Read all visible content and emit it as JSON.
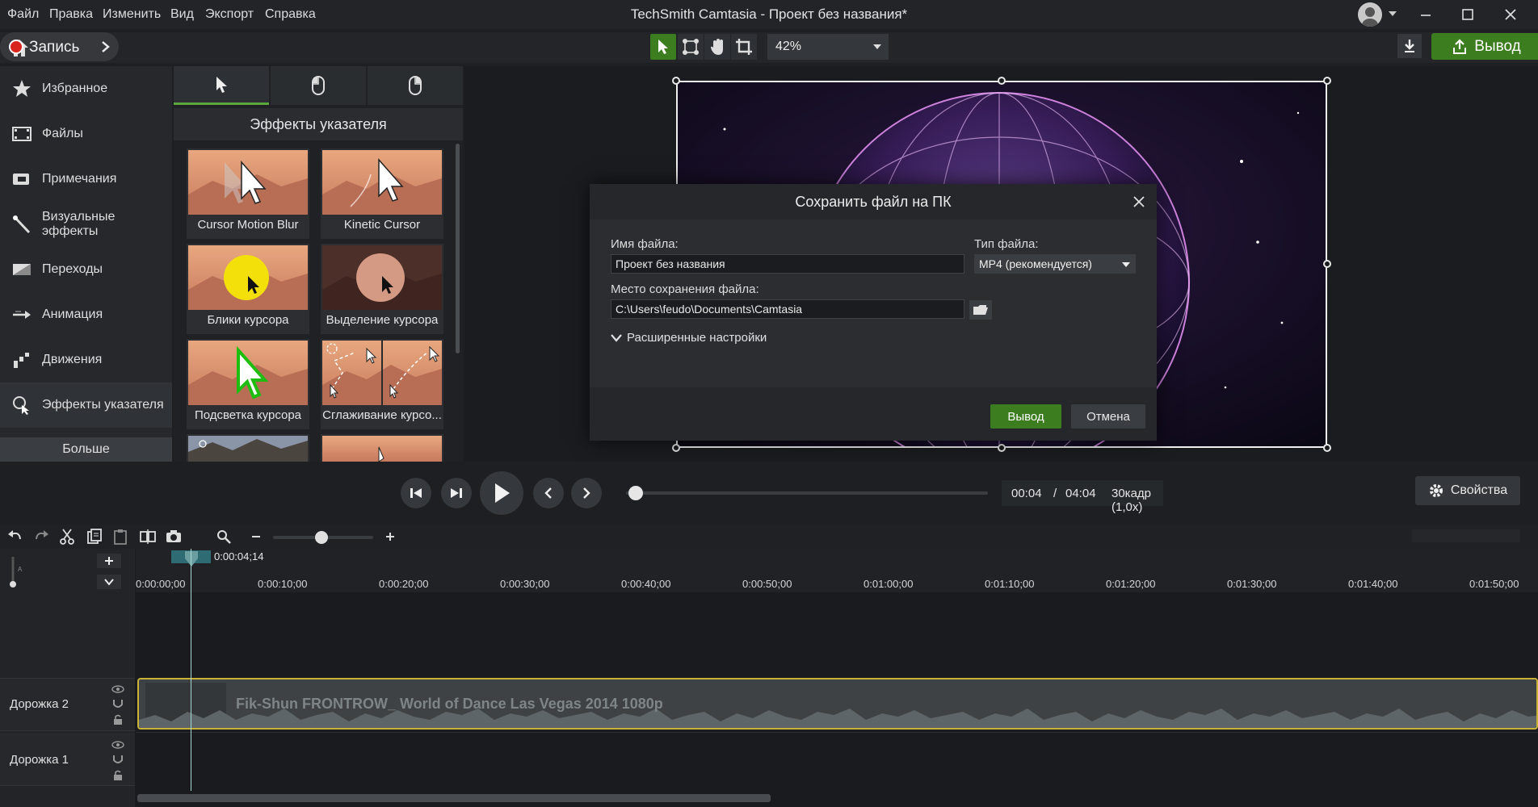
{
  "menubar": {
    "items": [
      "Файл",
      "Правка",
      "Изменить",
      "Вид",
      "Экспорт",
      "Справка"
    ],
    "title": "TechSmith Camtasia - Проект без названия*"
  },
  "toolbar": {
    "record_label": "Запись",
    "zoom_value": "42%",
    "export_label": "Вывод"
  },
  "sidebar": {
    "items": [
      {
        "label": "Избранное",
        "icon": "star-icon"
      },
      {
        "label": "Файлы",
        "icon": "film-icon"
      },
      {
        "label": "Примечания",
        "icon": "annotation-icon"
      },
      {
        "label": "Визуальные эффекты",
        "icon": "magic-wand-icon"
      },
      {
        "label": "Переходы",
        "icon": "transition-icon"
      },
      {
        "label": "Анимация",
        "icon": "animation-arrow-icon"
      },
      {
        "label": "Движения",
        "icon": "behaviors-icon"
      },
      {
        "label": "Эффекты указателя",
        "icon": "cursor-effects-icon"
      }
    ],
    "more_label": "Больше"
  },
  "effects_panel": {
    "title": "Эффекты указателя",
    "tabs": [
      "cursor-tab-icon",
      "left-click-tab-icon",
      "right-click-tab-icon"
    ],
    "thumbs": [
      {
        "label": "Cursor Motion Blur"
      },
      {
        "label": "Kinetic Cursor"
      },
      {
        "label": "Блики курсора"
      },
      {
        "label": "Выделение курсора"
      },
      {
        "label": "Подсветка курсора"
      },
      {
        "label": "Сглаживание курсо..."
      }
    ]
  },
  "dialog": {
    "title": "Сохранить файл на ПК",
    "filename_label": "Имя файла:",
    "filename_value": "Проект без названия",
    "filetype_label": "Тип файла:",
    "filetype_value": "MP4 (рекомендуется)",
    "location_label": "Место сохранения файла:",
    "location_value": "C:\\Users\\feudo\\Documents\\Camtasia",
    "advanced_label": "Расширенные настройки",
    "ok_label": "Вывод",
    "cancel_label": "Отмена"
  },
  "player": {
    "current_time": "00:04",
    "separator": "/",
    "total_time": "04:04",
    "fps": "30кадр (1,0x)",
    "properties_label": "Свойства"
  },
  "timeline": {
    "playhead_time": "0:00:04;14",
    "ticks": [
      "0:00:00;00",
      "0:00:10;00",
      "0:00:20;00",
      "0:00:30;00",
      "0:00:40;00",
      "0:00:50;00",
      "0:01:00;00",
      "0:01:10;00",
      "0:01:20;00",
      "0:01:30;00",
      "0:01:40;00",
      "0:01:50;00"
    ],
    "tracks": [
      "Дорожка 2",
      "Дорожка 1"
    ],
    "clip_title": "Fik-Shun  FRONTROW_ World of Dance Las Vegas 2014  1080p"
  },
  "colors": {
    "accent_green": "#3c7d1f",
    "clip_border": "#c9b236"
  }
}
